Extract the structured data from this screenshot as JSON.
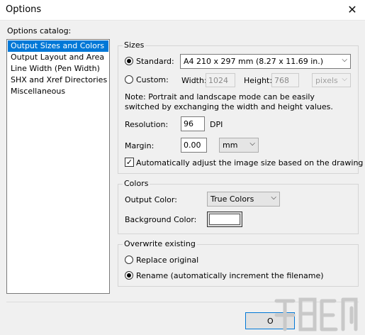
{
  "window": {
    "title": "Options",
    "close_glyph": "✕"
  },
  "catalog": {
    "label": "Options catalog:",
    "items": [
      "Output Sizes and Colors",
      "Output Layout and Area",
      "Line Width (Pen Width)",
      "SHX and Xref Directories",
      "Miscellaneous"
    ],
    "selected": "Output Sizes and Colors"
  },
  "sizes": {
    "group_title": "Sizes",
    "standard": {
      "label": "Standard:",
      "checked": true,
      "value": "A4 210 x 297 mm (8.27 x 11.69 in.)"
    },
    "custom": {
      "label": "Custom:",
      "checked": false,
      "width_label": "Width:",
      "width_value": "1024",
      "height_label": "Height:",
      "height_value": "768",
      "unit_value": "pixels"
    },
    "note": "Note: Portrait and landscape mode can be easily switched by exchanging the width and height values.",
    "resolution": {
      "label": "Resolution:",
      "value": "96",
      "unit": "DPI"
    },
    "margin": {
      "label": "Margin:",
      "value": "0.00",
      "unit_value": "mm"
    },
    "auto_adjust": {
      "label": "Automatically adjust the image size based on the drawing",
      "checked": true
    }
  },
  "colors": {
    "group_title": "Colors",
    "output_color": {
      "label": "Output Color:",
      "value": "True Colors"
    },
    "background_color": {
      "label": "Background Color:",
      "swatch": "#ffffff"
    }
  },
  "overwrite": {
    "group_title": "Overwrite existing",
    "replace": {
      "label": "Replace original",
      "checked": false
    },
    "rename": {
      "label": "Rename (automatically increment the filename)",
      "checked": true
    }
  },
  "buttons": {
    "ok_visible_text": "O"
  },
  "icons": {
    "dropdown_arrow": "chevron-down-icon",
    "check_mark": "checkmark-icon",
    "close": "close-icon"
  },
  "theme": {
    "selection": "#0078d7",
    "dialog_bg": "#f0f0f0",
    "group_border": "#d5d5d5"
  }
}
